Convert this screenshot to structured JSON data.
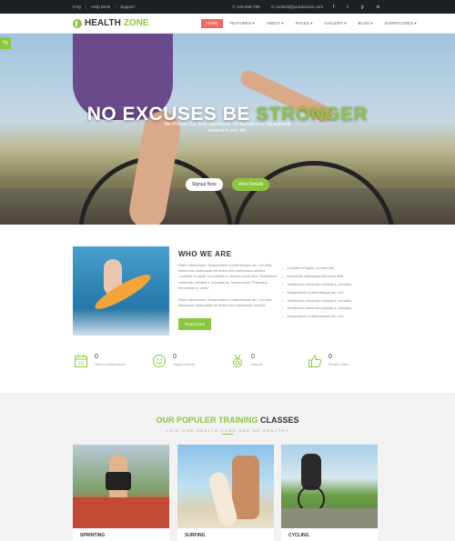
{
  "topbar": {
    "links": [
      "FAQ",
      "Help Desk",
      "Support"
    ],
    "phone": "123-456-789",
    "email": "contact@yourdomain.com",
    "social_icons": [
      "facebook-icon",
      "twitter-icon",
      "google-plus-icon",
      "linkedin-icon"
    ]
  },
  "nav": {
    "logo_first": "HEALTH",
    "logo_second": "ZONE",
    "items": [
      "HOME",
      "FEATURES",
      "ABOUT",
      "PAGES",
      "GALLERY",
      "BLOG",
      "SHORTCODES"
    ],
    "active_index": 0
  },
  "hero": {
    "title_white": "NO EXCUSES BE",
    "title_green": "STRONGER",
    "subtitle": "We Provide Our Best opportunity TO Burned your Fat and best workout in your life.",
    "btn_signup": "Signup Now",
    "btn_details": "View Details"
  },
  "who": {
    "title": "WHO WE ARE",
    "para1": "Etiam ullamcorper. Suspendisse a pellentesque dui, non felis. Maecenas malesuada elit lectus felis malesuada ultricies. Curabitur et ligula. Ut molestie a, ultricies porta urna. Vestibulum commodo volutpat a, convallis ac, laoreet enim. Phasellus fermentum in, dolor.",
    "para2": "Etiam ullamcorper. Suspendisse a pellentesque dui, non felis. Maecenas malesuada elit lectus felis malesuada ultricies.",
    "read_more": "Read more",
    "checks": [
      "Curabitur et ligula. Ut mole sits",
      "Maecenas malesuada elit lectus felis",
      "Vestibulum commodo volutpat a, convallis.",
      "Suspendisse a pellentesque dui, non.",
      "Vestibulum commodo volutpat a, convallis.",
      "Vestibulum commodo volutpat a, convallis.",
      "Suspendisse a pellentesque dui, non."
    ]
  },
  "stats": [
    {
      "icon": "calendar-icon",
      "value": "0",
      "label": "Years of Experience",
      "calendar_day": "15"
    },
    {
      "icon": "smiley-icon",
      "value": "0",
      "label": "Happy Clients"
    },
    {
      "icon": "medal-icon",
      "value": "0",
      "label": "Awards"
    },
    {
      "icon": "thumbs-up-icon",
      "value": "0",
      "label": "People Likes"
    }
  ],
  "classes": {
    "title_green": "OUR POPULER TRAINING",
    "title_dark": "CLASSES",
    "subtitle": "JOIN OUR HEALTH ZONE AND BE HEALTHY",
    "cards": [
      {
        "name": "SPRINTING"
      },
      {
        "name": "SURFING"
      },
      {
        "name": "CYCLING"
      }
    ]
  },
  "colors": {
    "accent": "#8cc63f",
    "nav_active": "#f16a5a",
    "topbar": "#1d2024"
  }
}
